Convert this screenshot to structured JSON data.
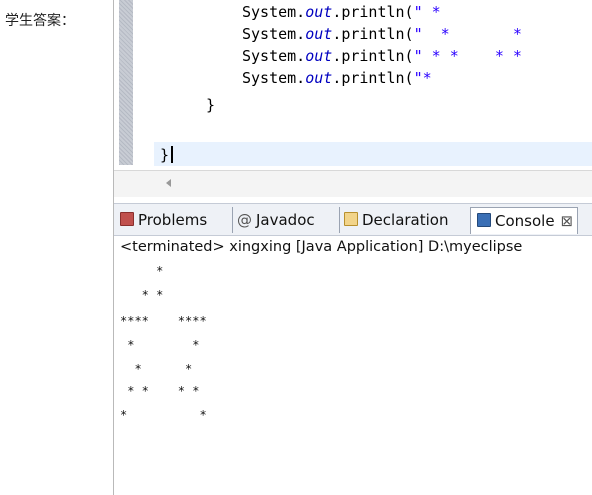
{
  "label": "学生答案：",
  "editor": {
    "code_lines": [
      {
        "prefix": "System.",
        "out": "out",
        "call": ".println(",
        "string": "\" *"
      },
      {
        "prefix": "System.",
        "out": "out",
        "call": ".println(",
        "string": "\"  *       *"
      },
      {
        "prefix": "System.",
        "out": "out",
        "call": ".println(",
        "string": "\" * *    * *"
      },
      {
        "prefix": "System.",
        "out": "out",
        "call": ".println(",
        "string": "\"*"
      }
    ],
    "brace_inner": "}",
    "brace_outer": "}"
  },
  "tabs": [
    {
      "label": "Problems",
      "icon": "problems-icon",
      "color": "#c0504d"
    },
    {
      "label": "Javadoc",
      "icon": "at-icon",
      "prefix": "@"
    },
    {
      "label": "Declaration",
      "icon": "declaration-icon",
      "color": "#d9a441"
    },
    {
      "label": "Console",
      "icon": "console-icon",
      "color": "#3a6fb5",
      "suffix": "⊠"
    }
  ],
  "console": {
    "header": "<terminated> xingxing [Java Application] D:\\myeclipse",
    "output": [
      "     *",
      "   * *",
      "****    ****",
      " *        *",
      "  *      *",
      " * *    * *",
      "*          *"
    ]
  },
  "colors": {
    "current_line": "#e8f2fe",
    "string": "#2a00ff",
    "field": "#0000c0"
  }
}
